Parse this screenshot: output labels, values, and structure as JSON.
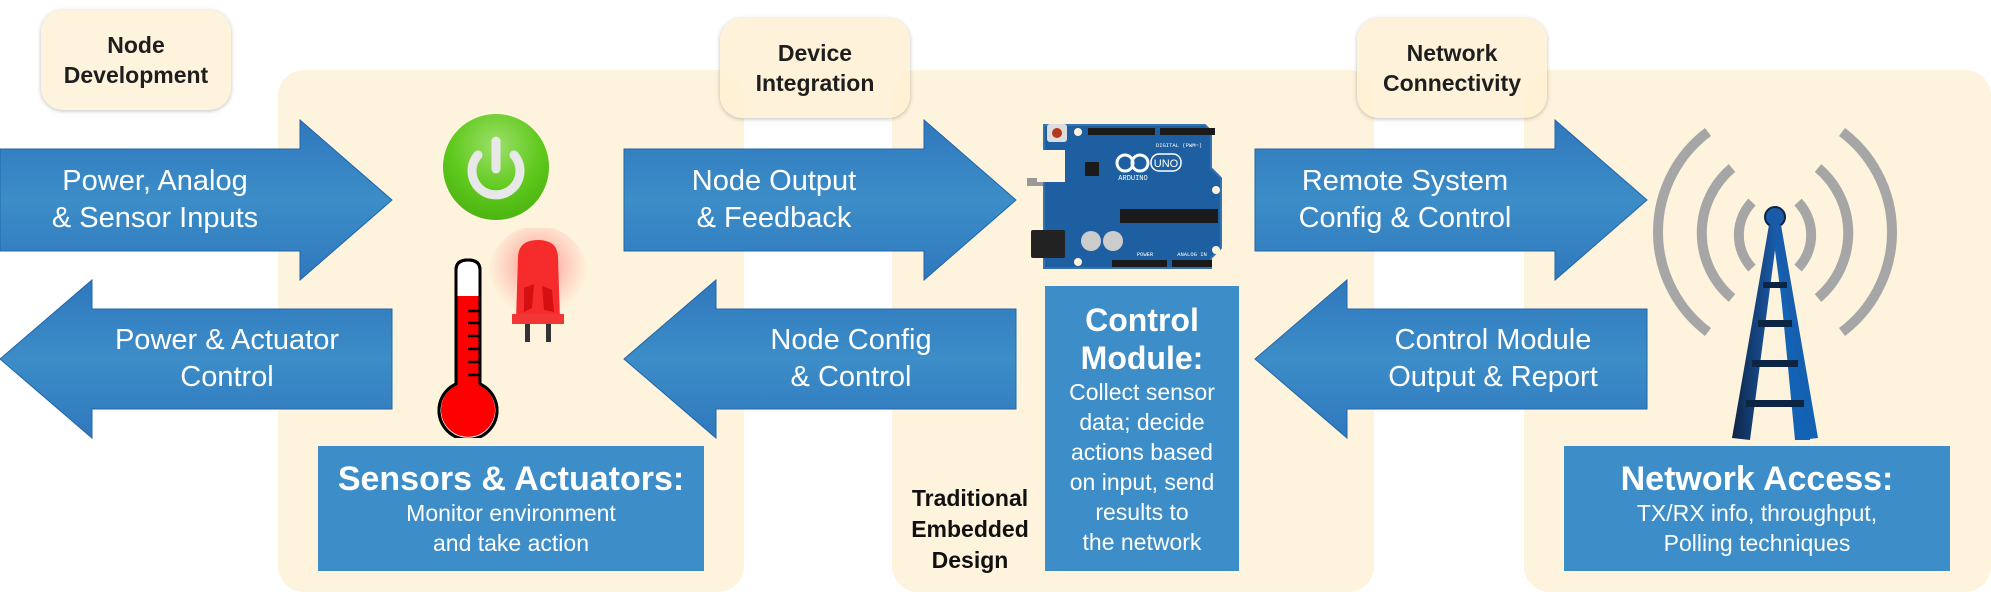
{
  "colors": {
    "panel": "#fef3dc",
    "arrow": "#3c8dc8",
    "arrow_edge": "#2166a8",
    "infobox": "#3c8dc8",
    "text_dark": "#1e1e1e"
  },
  "stage_tags": [
    {
      "label": "Node\nDevelopment"
    },
    {
      "label": "Device\nIntegration"
    },
    {
      "label": "Network\nConnectivity"
    }
  ],
  "arrows": [
    {
      "direction": "right",
      "label": "Power, Analog\n& Sensor Inputs"
    },
    {
      "direction": "left",
      "label": "Power & Actuator\nControl"
    },
    {
      "direction": "right",
      "label": "Node Output\n& Feedback"
    },
    {
      "direction": "left",
      "label": "Node Config\n& Control"
    },
    {
      "direction": "right",
      "label": "Remote System\nConfig & Control"
    },
    {
      "direction": "left",
      "label": "Control Module\nOutput & Report"
    }
  ],
  "infoboxes": {
    "sensors": {
      "title": "Sensors & Actuators:",
      "desc": "Monitor environment\nand take action"
    },
    "control": {
      "title": "Control\nModule:",
      "desc": "Collect sensor\ndata; decide\nactions based\non input, send\nresults to\nthe network"
    },
    "network": {
      "title": "Network Access:",
      "desc": "TX/RX info, throughput,\nPolling techniques"
    }
  },
  "caption": {
    "label": "Traditional\nEmbedded\nDesign"
  },
  "icons": {
    "power": "power-button-icon",
    "thermometer": "thermometer-icon",
    "led": "red-led-icon",
    "arduino": "arduino-uno-board-icon",
    "tower": "radio-tower-icon",
    "arduino_text": {
      "brand": "ARDUINO",
      "model": "UNO",
      "digital": "DIGITAL (PWM~)",
      "power": "POWER",
      "analog": "ANALOG IN"
    }
  }
}
